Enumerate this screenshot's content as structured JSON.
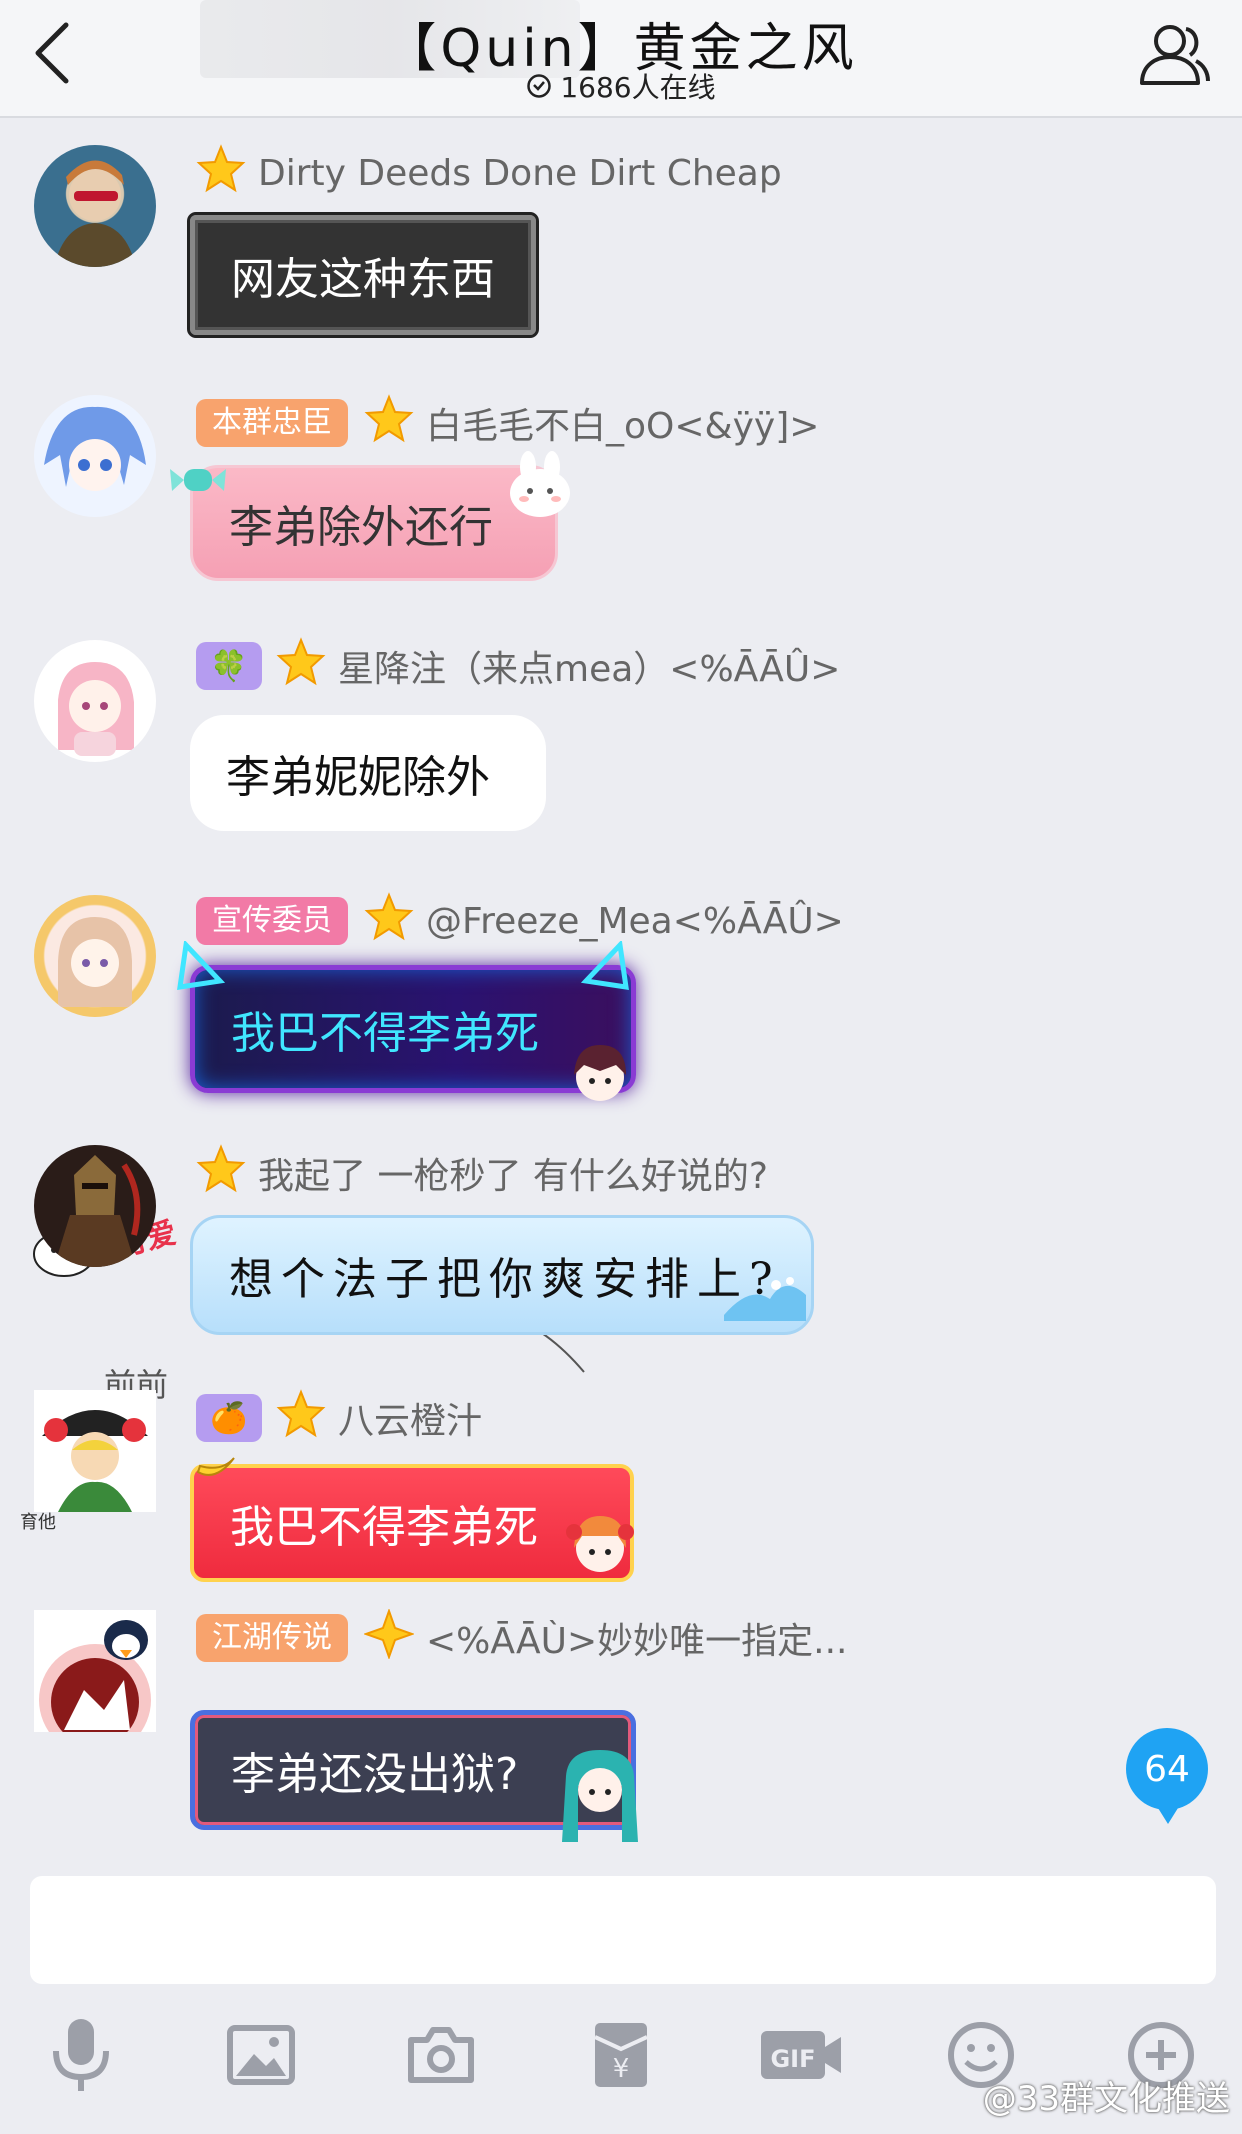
{
  "header": {
    "title": "【Quin】黄金之风",
    "online": "1686人在线"
  },
  "messages": [
    {
      "tag": "",
      "badge": "",
      "star_color": "gold",
      "name": "Dirty Deeds Done Dirt Cheap",
      "text": "网友这种东西"
    },
    {
      "tag": "本群忠臣",
      "badge": "",
      "star_color": "gold",
      "name": "白毛毛不白_oO<&ÿÿ]>",
      "text": "李弟除外还行"
    },
    {
      "tag": "",
      "badge": "🍀",
      "star_color": "gold",
      "name": "星降注（来点mea）<%ĀĀÛ>",
      "text": "李弟妮妮除外"
    },
    {
      "tag": "宣传委员",
      "badge": "",
      "star_color": "gold",
      "name": "@Freeze_Mea<%ĀĀÛ>",
      "text": "我巴不得李弟死"
    },
    {
      "tag": "",
      "badge": "",
      "star_color": "gold",
      "name": "我起了 一枪秒了 有什么好说的?",
      "text": "想个法子把你爽安排上?"
    },
    {
      "tag": "",
      "badge": "🍊",
      "star_color": "gold",
      "name": "八云橙汁",
      "text": "我巴不得李弟死"
    },
    {
      "tag": "江湖传说",
      "badge": "",
      "star_color": "diamond",
      "name": "<%ĀĀÙ>妙妙唯一指定...",
      "text": "李弟还没出狱?"
    }
  ],
  "avatar_overlay_text": {
    "a6_top": "前前",
    "a6_side": "育他",
    "a3_sticker": "我可爱"
  },
  "unread_count": "64",
  "input": {
    "placeholder": ""
  },
  "toolbar": [
    "mic-icon",
    "image-icon",
    "camera-icon",
    "red-packet-icon",
    "gif-icon",
    "emoji-icon",
    "plus-icon"
  ],
  "watermark": "@33群文化推送",
  "colors": {
    "tag_orange": "#f8a36d",
    "tag_pink": "#f27aa6",
    "badge_purple": "#b59cf0",
    "unread_blue": "#1fa3f3",
    "star_gold": "#ffc81a"
  }
}
